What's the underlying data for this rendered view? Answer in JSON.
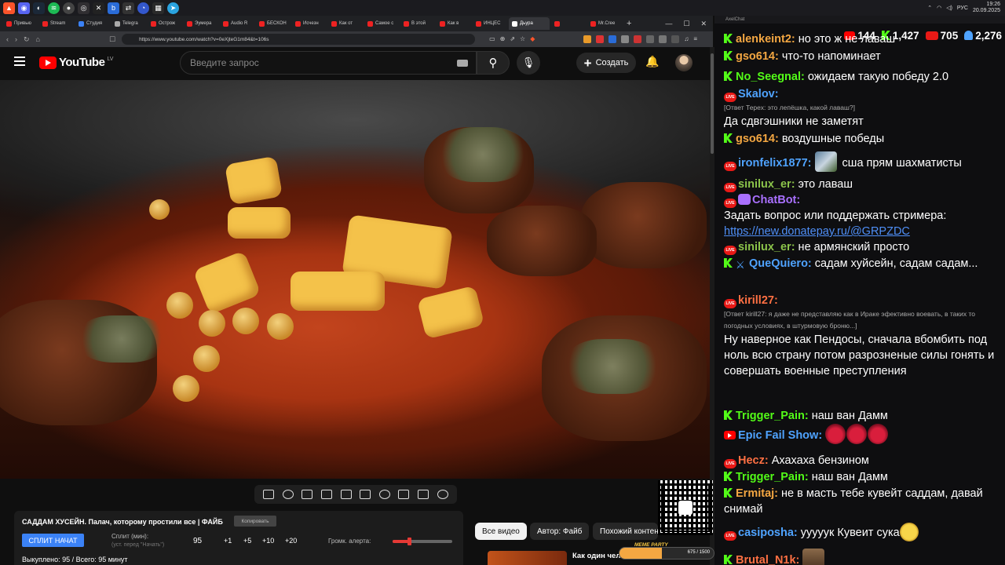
{
  "taskbar": {
    "time": "19:26",
    "date": "20.09.2025",
    "lang": "РУС",
    "icons": [
      "brave-icon",
      "discord-icon",
      "steam-icon",
      "spotify-icon",
      "chrome-icon",
      "obs-icon",
      "capcut-icon",
      "bandcamp-icon",
      "network-icon",
      "dashboard-icon",
      "telegram-icon"
    ]
  },
  "browser": {
    "tabs": [
      "Привью",
      "Stream",
      "Студия",
      "Telegra",
      "Острож",
      "Эумера",
      "Audio R",
      "БЕСКОН",
      "Исчезн",
      "Как от",
      "Самое с",
      "В этой",
      "Как в",
      "ИНЦЕС",
      "Дьура",
      "",
      "Mr.Cree"
    ],
    "url": "https://www.youtube.com/watch?v=0eXjteG1m84&t=106s"
  },
  "youtube": {
    "logo": "YouTube",
    "country": "LV",
    "search_placeholder": "Введите запрос",
    "create_label": "Создать"
  },
  "panel": {
    "title": "САДДАМ ХУСЕЙН. Палач, которому простили все | ФАЙБ",
    "copy_label": "Копировать",
    "split_button": "СПЛИТ НАЧАТ",
    "split_label": "Сплит (мин):",
    "split_sub": "(уст. перед \"Начать\")",
    "split_value": "95",
    "increments": [
      "+1",
      "+5",
      "+10",
      "+20"
    ],
    "alert_label": "Громк. алерта:",
    "alert_volume": 0.27,
    "bought": "Выкуплено: 95 / Всего: 95 минут"
  },
  "chips": [
    "Все видео",
    "Автор: Файб",
    "Похожий контент"
  ],
  "recommend": {
    "title": "Как один чел"
  },
  "meme": {
    "label": "MEME PARTY",
    "progress_text": "675 / 1500",
    "progress": 0.45
  },
  "chat": {
    "app": "AxelChat",
    "stats": {
      "youtube": "144",
      "kick": "1,427",
      "live": "705",
      "viewers": "2,276"
    },
    "live_badge": "LIVE",
    "messages": [
      {
        "nick": "alenkeint2:",
        "text": " но это ж не лаваш",
        "platform": "kick",
        "color": "#f4a742"
      },
      {
        "nick": "gso614:",
        "text": " что-то напоминает",
        "platform": "kick",
        "color": "#f4a742"
      },
      {
        "nick": "No_Seegnal:",
        "text": " ожидаем такую победу 2.0",
        "platform": "kick",
        "color": "#53fc18"
      },
      {
        "nick": "Skalov:",
        "reply": "[Ответ Терех: это лепёшка, какой лаваш?]",
        "text": "Да сдвгэшники не заметят",
        "platform": "live",
        "color": "#4fa3ff"
      },
      {
        "nick": "gso614:",
        "text": " воздушные победы",
        "platform": "kick",
        "color": "#f4a742"
      },
      {
        "nick": "ironfelix1877:",
        "text": " сша прям шахматисты",
        "platform": "live",
        "color": "#4fa3ff"
      },
      {
        "nick": "sinilux_er:",
        "text": " это лаваш",
        "platform": "live",
        "color": "#8bc34a"
      },
      {
        "nick": "ChatBot:",
        "text": "Задать вопрос или поддержать стримера:",
        "link": "https://new.donatepay.ru/@GRPZDC",
        "platform": "live",
        "color": "#a970ff"
      },
      {
        "nick": "sinilux_er:",
        "text": " не армянский просто",
        "platform": "live",
        "color": "#8bc34a"
      },
      {
        "nick": "QueQuiero:",
        "text": " садам хуйсейн, садам садам...",
        "platform": "kick",
        "color": "#4fa3ff"
      },
      {
        "nick": "kirill27:",
        "reply": "[Ответ kirill27: я даже не представляю как в Ираке эфективно воевать, в таких то погодных условиях, в штурмовую броню...]",
        "text": "Ну наверное как Пендосы, сначала вбомбить под ноль всю страну потом разрозненые силы гонять и совершать военные преступления",
        "platform": "live",
        "color": "#ff7043"
      },
      {
        "nick": "Trigger_Pain:",
        "text": " наш ван Дамм",
        "platform": "kick",
        "color": "#53fc18"
      },
      {
        "nick": "Epic Fail Show:",
        "text": "",
        "platform": "yt",
        "color": "#4fa3ff"
      },
      {
        "nick": "Hecz:",
        "text": " Ахахаха бензином",
        "platform": "live",
        "color": "#ff7043"
      },
      {
        "nick": "Trigger_Pain:",
        "text": " наш ван Дамм",
        "platform": "kick",
        "color": "#53fc18"
      },
      {
        "nick": "Ermitaj:",
        "text": " не в масть тебе кувейт саддам, давай снимай",
        "platform": "kick",
        "color": "#f4a742"
      },
      {
        "nick": "casiposha:",
        "text": " ууууук Кувеит сука",
        "platform": "live",
        "color": "#4fa3ff"
      },
      {
        "nick": "Brutal_N1k:",
        "text": "",
        "platform": "kick",
        "color": "#ff7043"
      }
    ]
  }
}
